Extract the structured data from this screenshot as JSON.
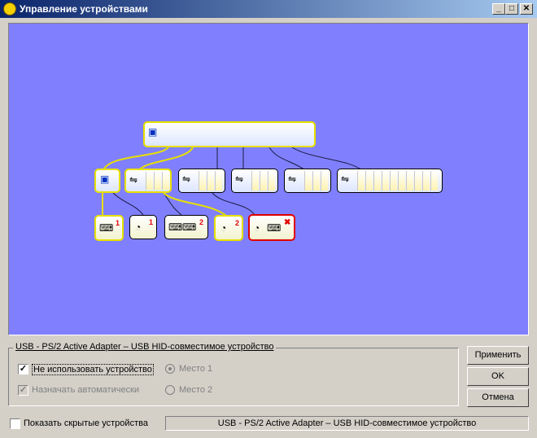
{
  "window": {
    "title": "Управление устройствами",
    "minimize_glyph": "_",
    "maximize_glyph": "□",
    "close_glyph": "✕"
  },
  "tree": {
    "badges": {
      "keyboard_hub": "1",
      "mouse_1": "1",
      "combo": "2",
      "mouse_2": "2",
      "error_mark": "✖"
    },
    "colors": {
      "canvas": "#8080ff",
      "selected_outline": "#e6e000",
      "error_outline": "#e00000"
    },
    "icons": [
      "computer-icon",
      "usb-icon",
      "keyboard-icon",
      "mouse-icon",
      "error-icon"
    ]
  },
  "group": {
    "legend": "USB - PS/2 Active Adapter  –  USB HID-совместимое устройство",
    "disable_device": {
      "label": "Не использовать устройство",
      "checked": true
    },
    "assign_auto": {
      "label": "Назначать автоматически",
      "checked": true,
      "disabled": true
    },
    "place1": {
      "label": "Место 1",
      "selected": true,
      "disabled": true
    },
    "place2": {
      "label": "Место 2",
      "selected": false,
      "disabled": true
    }
  },
  "buttons": {
    "apply": "Применить",
    "ok": "OK",
    "cancel": "Отмена"
  },
  "footer": {
    "show_hidden": {
      "label": "Показать скрытые устройства",
      "checked": false
    },
    "status": "USB - PS/2 Active Adapter  –  USB HID-совместимое устройство"
  }
}
